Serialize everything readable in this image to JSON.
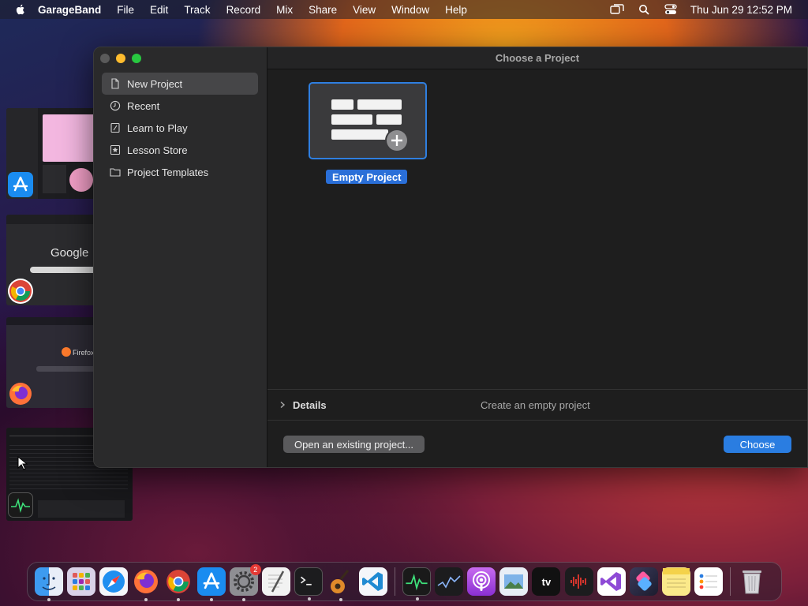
{
  "menubar": {
    "app_name": "GarageBand",
    "items": [
      "File",
      "Edit",
      "Track",
      "Record",
      "Mix",
      "Share",
      "View",
      "Window",
      "Help"
    ],
    "clock": "Thu Jun 29  12:52 PM"
  },
  "switcher": {
    "thumb_google_text": "Google",
    "thumb_firefox_text": "Firefox"
  },
  "window": {
    "title": "Choose a Project",
    "sidebar": [
      {
        "label": "New Project",
        "icon": "document-icon",
        "selected": true
      },
      {
        "label": "Recent",
        "icon": "clock-icon"
      },
      {
        "label": "Learn to Play",
        "icon": "guitar-book-icon"
      },
      {
        "label": "Lesson Store",
        "icon": "star-icon"
      },
      {
        "label": "Project Templates",
        "icon": "folder-icon"
      }
    ],
    "project": {
      "label": "Empty Project"
    },
    "details": {
      "label": "Details",
      "description": "Create an empty project"
    },
    "open_button": "Open an existing project...",
    "choose_button": "Choose"
  },
  "dock": {
    "system_settings_badge": "2",
    "tv_label": "tv",
    "items": [
      "finder-icon",
      "launchpad-icon",
      "safari-icon",
      "firefox-icon",
      "chrome-icon",
      "app-store-icon",
      "system-settings-icon",
      "textedit-icon",
      "terminal-icon",
      "garageband-icon",
      "vscode-icon",
      "activity-monitor-icon",
      "stocks-icon",
      "podcasts-icon",
      "preview-icon",
      "apple-tv-icon",
      "voice-memos-icon",
      "visual-studio-icon",
      "shortcuts-icon",
      "notes-icon",
      "reminders-icon",
      "trash-icon"
    ]
  },
  "colors": {
    "accent": "#2a7de1",
    "selection": "#2f7fe0",
    "window_bg": "#1e1e1e",
    "sidebar_bg": "#2a2a2b"
  }
}
